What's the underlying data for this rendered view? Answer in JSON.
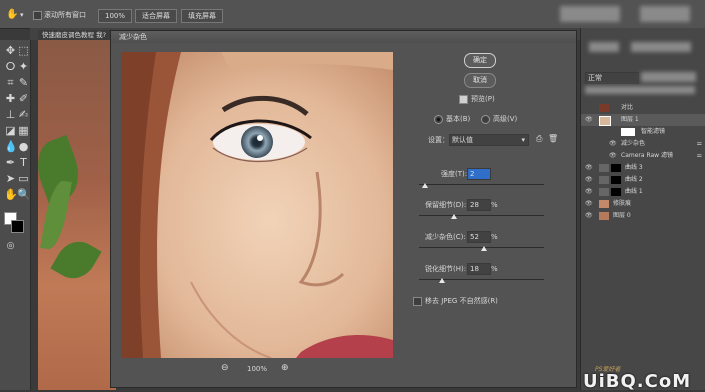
{
  "options_bar": {
    "show_all_windows": "滚动所有窗口",
    "zoom": "100%",
    "fit_screen": "适合屏幕",
    "fill_screen": "填充屏幕"
  },
  "document_tab": "快速磨皮调色教程 我?",
  "dialog": {
    "title": "减少杂色",
    "ok": "确定",
    "cancel": "取消",
    "preview": "预览(P)",
    "basic": "基本(B)",
    "advanced": "高级(V)",
    "settings_label": "设置：",
    "settings_value": "默认值",
    "strength_label": "强度(T):",
    "strength_value": "2",
    "preserve_details_label": "保留细节(D):",
    "preserve_details_value": "28",
    "reduce_color_noise_label": "减少杂色(C):",
    "reduce_color_noise_value": "52",
    "sharpen_details_label": "锐化细节(H):",
    "sharpen_details_value": "18",
    "percent": "%",
    "remove_jpeg": "移去 JPEG 不自然感(R)",
    "zoom_value": "100%",
    "strength_level": 0.05,
    "preserve_level": 0.28,
    "reduce_level": 0.52,
    "sharpen_level": 0.18
  },
  "layers_panel": {
    "mode": "正常",
    "layers": [
      {
        "name": "对比"
      },
      {
        "name": "图层 1"
      },
      {
        "name": "智能滤镜"
      },
      {
        "name": "减少杂色"
      },
      {
        "name": "Camera Raw 滤镜"
      },
      {
        "name": "曲线 3"
      },
      {
        "name": "曲线 2"
      },
      {
        "name": "曲线 1"
      },
      {
        "name": "修肤痕"
      },
      {
        "name": "图层 0"
      }
    ]
  },
  "watermark": {
    "text": "UiBQ.CoM",
    "sub": "PS爱好者"
  },
  "colors": {
    "accent_blue": "#2f6fc9",
    "lips": "#b3404a"
  }
}
